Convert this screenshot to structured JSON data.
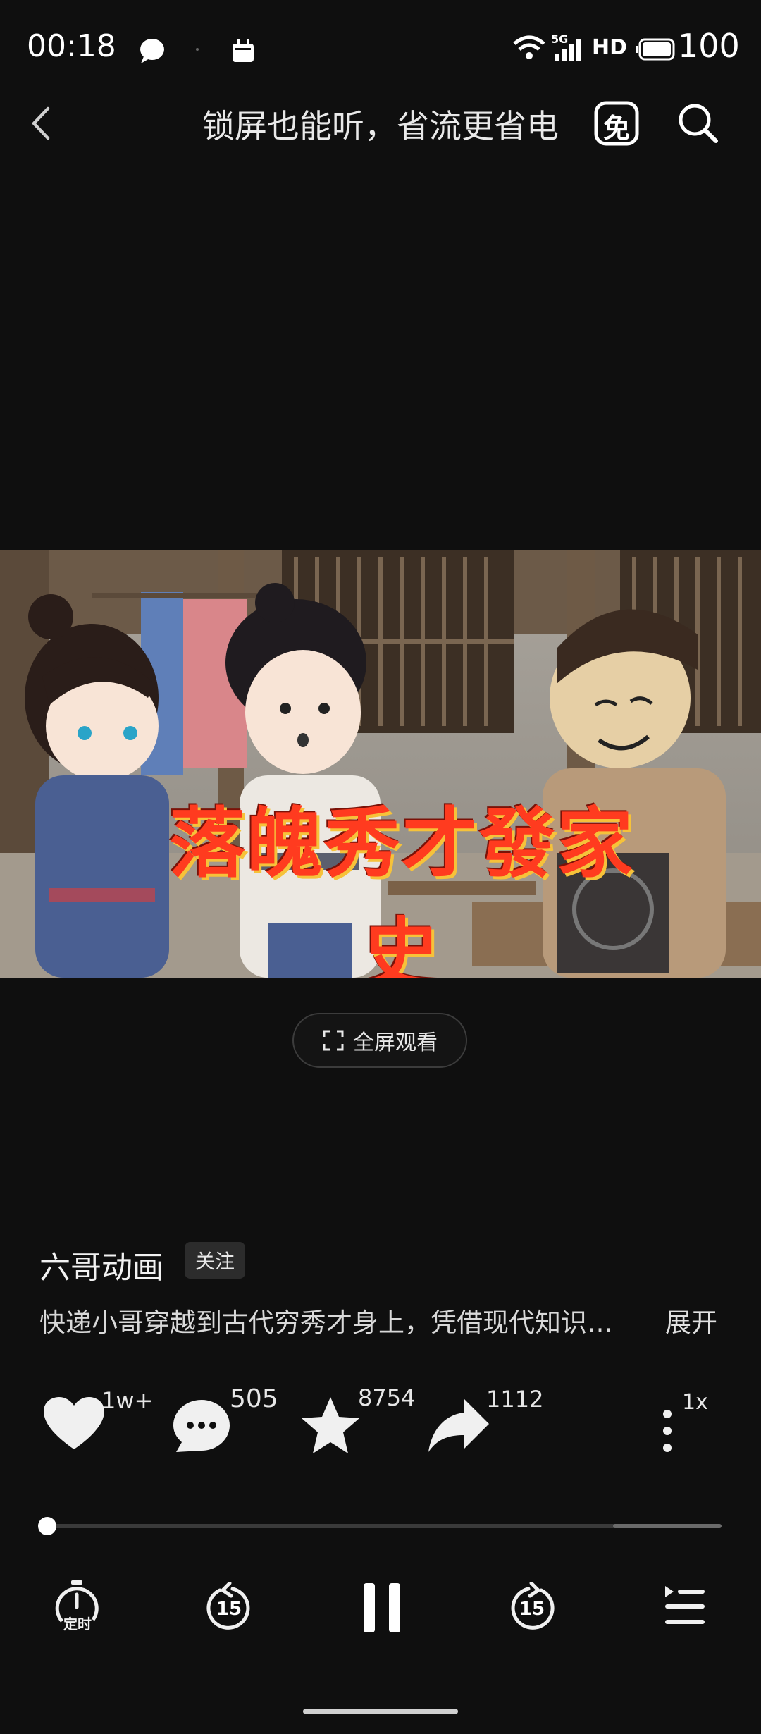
{
  "status_bar": {
    "time": "00:18",
    "network_label": "5G",
    "hd_label": "HD",
    "battery": "100",
    "icons": [
      "chat-bubble-icon",
      "calendar-icon",
      "wifi-icon",
      "signal-icon",
      "battery-icon"
    ]
  },
  "header": {
    "title": "锁屏也能听，省流更省电",
    "free_label": "免",
    "icons": [
      "back-arrow-icon",
      "search-icon"
    ]
  },
  "video": {
    "title_overlay": "落魄秀才發家史",
    "fullscreen_label": "全屏观看"
  },
  "author": {
    "name": "六哥动画",
    "follow_label": "关注"
  },
  "description": {
    "text": "快递小哥穿越到古代穷秀才身上，凭借现代知识…",
    "expand_label": "展开"
  },
  "actions": {
    "like_count": "1w+",
    "comment_count": "505",
    "favorite_count": "8754",
    "share_count": "1112",
    "speed_label": "1x"
  },
  "player": {
    "timer_label": "定时",
    "rewind_label": "15",
    "forward_label": "15",
    "progress_fraction": 0.0,
    "buffered_fraction": 0.84
  },
  "colors": {
    "background": "#0f0f0f",
    "text": "#ffffff",
    "title_overlay": "#ff3b1f"
  }
}
